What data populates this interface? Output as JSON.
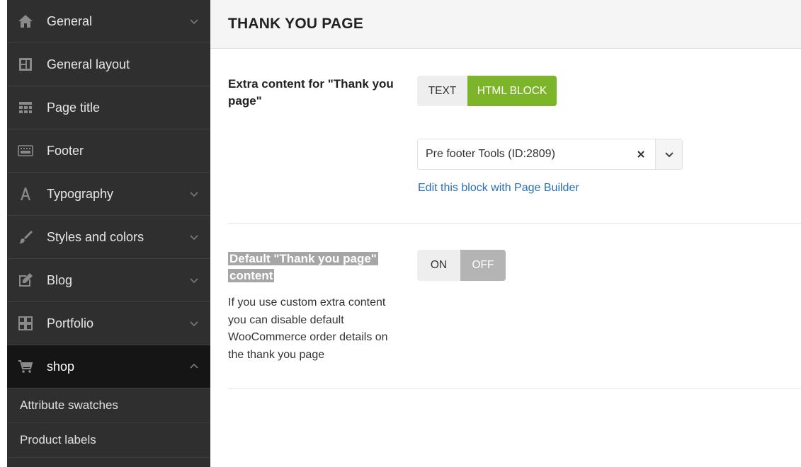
{
  "sidebar": {
    "items": [
      {
        "label": "General",
        "icon": "home-icon",
        "chevron": "down"
      },
      {
        "label": "General layout",
        "icon": "layout-icon",
        "chevron": ""
      },
      {
        "label": "Page title",
        "icon": "page-title-icon",
        "chevron": ""
      },
      {
        "label": "Footer",
        "icon": "footer-icon",
        "chevron": ""
      },
      {
        "label": "Typography",
        "icon": "typography-icon",
        "chevron": "down"
      },
      {
        "label": "Styles and colors",
        "icon": "brush-icon",
        "chevron": "down"
      },
      {
        "label": "Blog",
        "icon": "edit-icon",
        "chevron": "down"
      },
      {
        "label": "Portfolio",
        "icon": "grid-icon",
        "chevron": "down"
      },
      {
        "label": "shop",
        "icon": "cart-icon",
        "chevron": "up"
      }
    ],
    "sub_items": [
      {
        "label": "Attribute swatches"
      },
      {
        "label": "Product labels"
      }
    ]
  },
  "main": {
    "title": "THANK YOU PAGE",
    "extra_content": {
      "title": "Extra content for \"Thank you page\"",
      "buttons": [
        {
          "label": "TEXT",
          "selected": false
        },
        {
          "label": "HTML BLOCK",
          "selected": true
        }
      ],
      "select_value": "Pre footer Tools (ID:2809)",
      "edit_link": "Edit this block with Page Builder"
    },
    "default_content": {
      "title": "Default \"Thank you page\" content",
      "description": "If you use custom extra content you can disable default WooCommerce order details on the thank you page",
      "buttons": [
        {
          "label": "ON",
          "selected": false
        },
        {
          "label": "OFF",
          "selected": true
        }
      ]
    }
  },
  "colors": {
    "sidebar_bg": "#2f2f2f",
    "sidebar_active_bg": "#151515",
    "accent_green": "#7db52a",
    "selected_grey": "#b4b4b4",
    "link_blue": "#2a6fb0"
  }
}
